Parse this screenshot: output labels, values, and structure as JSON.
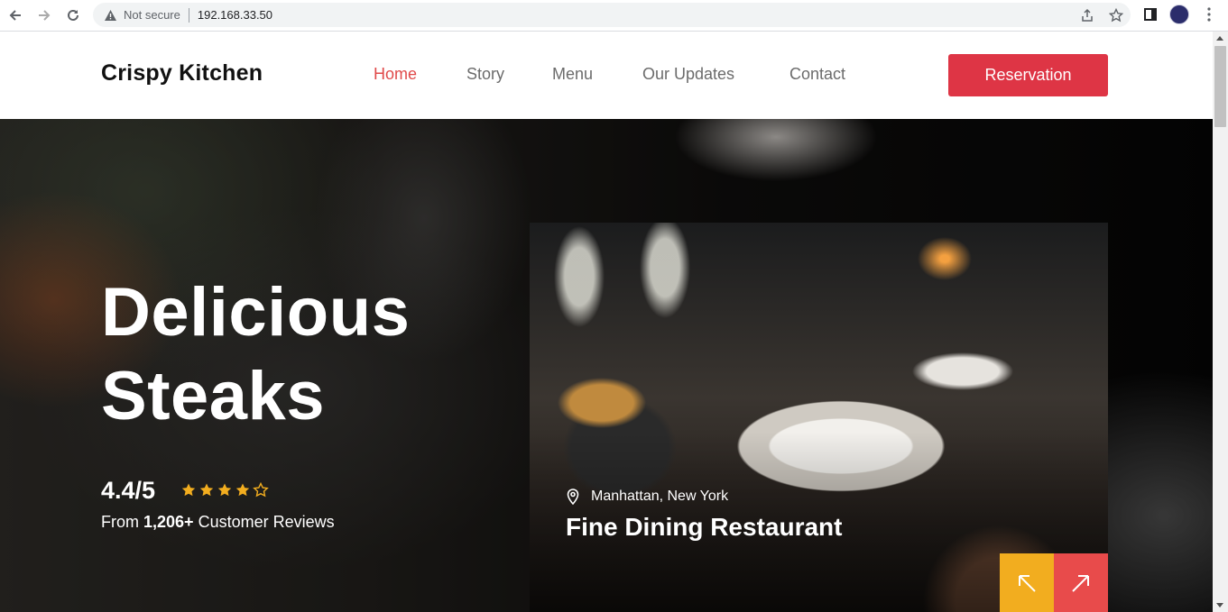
{
  "browser": {
    "security_label": "Not secure",
    "url": "192.168.33.50",
    "icons": [
      "back-icon",
      "forward-icon",
      "reload-icon",
      "warning-icon",
      "share-icon",
      "star-icon",
      "sidebar-icon",
      "profile-avatar",
      "more-menu-icon"
    ]
  },
  "navbar": {
    "brand": "Crispy Kitchen",
    "links": [
      {
        "label": "Home",
        "active": true
      },
      {
        "label": "Story",
        "active": false
      },
      {
        "label": "Menu",
        "active": false
      },
      {
        "label": "Our Updates",
        "active": false
      },
      {
        "label": "Contact",
        "active": false
      }
    ],
    "reservation_label": "Reservation"
  },
  "hero": {
    "title_line1": "Delicious",
    "title_line2": "Steaks",
    "rating": "4.4/5",
    "stars_filled": 4,
    "stars_total": 5,
    "reviews_prefix": "From ",
    "reviews_count": "1,206+",
    "reviews_suffix": " Customer Reviews"
  },
  "card": {
    "location": "Manhattan, New York",
    "title": "Fine Dining Restaurant",
    "prev_icon": "arrow-up-left-icon",
    "next_icon": "arrow-up-right-icon"
  },
  "colors": {
    "accent_red": "#de3545",
    "active_link": "#e04a4a",
    "star_gold": "#f2ad1f",
    "prev_btn": "#f2ad1f",
    "next_btn": "#e84b4b"
  }
}
